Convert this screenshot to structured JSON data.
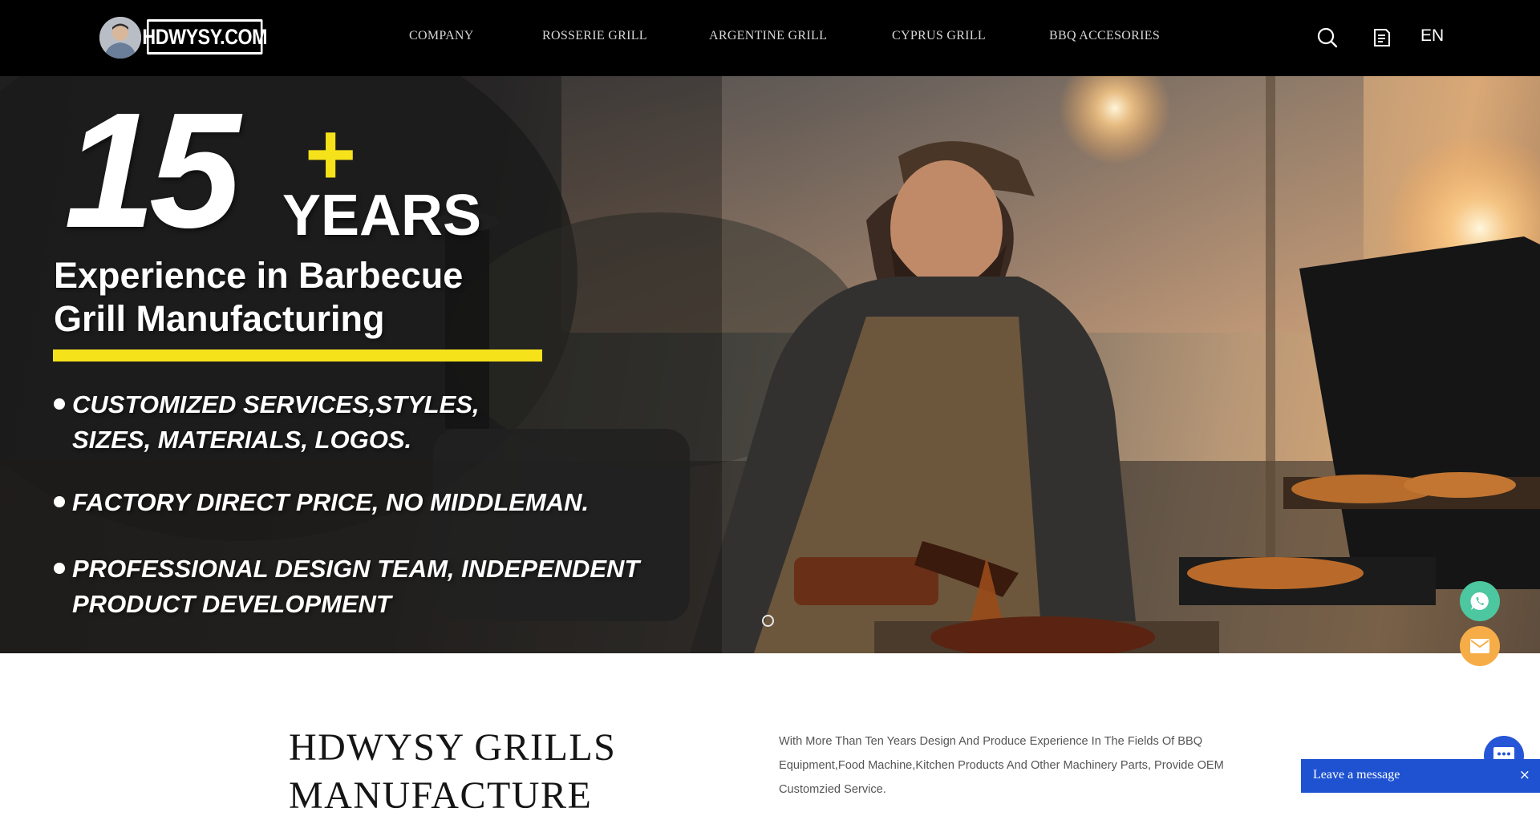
{
  "header": {
    "logo_text": "HDWYSY.COM",
    "nav": [
      {
        "label": "COMPANY"
      },
      {
        "label": "ROSSERIE GRILL"
      },
      {
        "label": "ARGENTINE GRILL"
      },
      {
        "label": "CYPRUS GRILL"
      },
      {
        "label": "BBQ ACCESORIES"
      }
    ],
    "icons": [
      "search-icon",
      "document-icon"
    ],
    "language": "EN"
  },
  "hero": {
    "years_number": "15",
    "plus": "+",
    "years_word": "YEARS",
    "experience_line1": "Experience in Barbecue",
    "experience_line2": "Grill Manufacturing",
    "accent_color": "#f5e21b",
    "bullets": [
      {
        "line1": "CUSTOMIZED SERVICES,STYLES,",
        "line2": "SIZES, MATERIALS, LOGOS."
      },
      {
        "line1": "FACTORY DIRECT PRICE, NO MIDDLEMAN.",
        "line2": ""
      },
      {
        "line1": "PROFESSIONAL DESIGN TEAM, INDEPENDENT",
        "line2": "PRODUCT DEVELOPMENT"
      }
    ],
    "slide_count": 1,
    "active_slide": 1
  },
  "floating": {
    "whatsapp_color": "#4dc7a0",
    "mail_color": "#f6ad48"
  },
  "intro": {
    "title_line1": "HDWYSY GRILLS",
    "title_line2": "MANUFACTURE",
    "text": "With More Than Ten Years Design And Produce Experience In The Fields Of BBQ Equipment,Food Machine,Kitchen Products And Other Machinery Parts,  Provide OEM Customzied Service."
  },
  "chat": {
    "label": "Leave a message",
    "close": "×",
    "color": "#1e52d1"
  }
}
